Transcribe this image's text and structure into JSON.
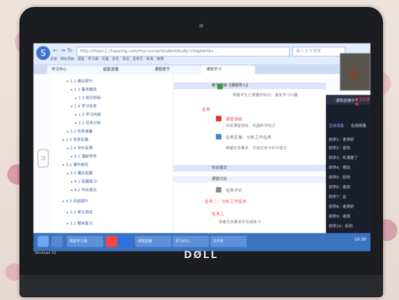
{
  "browser": {
    "logo_letter": "S",
    "nav_glyphs": "← → ↻",
    "address": "http://mooc1.chaoxing.com/mycourse/studentstudy?chapterId=...",
    "search_placeholder": "输入文字搜索",
    "bookmarks": "百度 · 网址导航 · 超星 · 学习通 · 天猫 · 京东 · 淘宝 · 爱奇艺 · 新浪 · 微博",
    "tabs": [
      "学习中心",
      "超星直播",
      "课程章节",
      "课程学习"
    ]
  },
  "tree": {
    "items": [
      "1.1 绪论部分",
      "1.2 基本概念",
      "1.3 知识目标",
      "1.4 学习任务",
      "1.5 学习内容",
      "2.1 任务分析",
      "2.2 任务准备",
      "2.3 任务实施",
      "2.4 评价反馈",
      "3.1 课前导学",
      "3.2 课中探究",
      "3.3 课后拓展",
      "4.1 拓展练习",
      "4.2 作业提交",
      "4.3 总结提升",
      "5.1 单元测试",
      "5.2 期末复习"
    ],
    "expand_glyph": "⊐"
  },
  "content": {
    "header_band": "教学视频【课程导入】",
    "intro_text": "观看学生已掌握的知识，激发学习兴趣",
    "section_title": "任务",
    "item1_title": "课堂测验",
    "item1_text": "完成课堂测验，巩固所学知识",
    "item2_title": "任务实施：分析工作任务",
    "item2_text": "根据任务要求，完成任务分析并提交",
    "band2": "作业提交",
    "band3": "课堂讨论",
    "item3_title": "任务评价",
    "item4_title": "任务二：分析工作任务",
    "item5_title": "任务三",
    "item5_text": "查看任务要求并完成练习"
  },
  "live_panel": {
    "host": "课程直播中",
    "badge": "● 正在直播",
    "tabs": [
      "互动消息",
      "在线观看"
    ],
    "messages": [
      "同学1：老师好",
      "同学2：收到",
      "同学3：听清楚了",
      "同学4：明白",
      "同学5：好的",
      "同学6：收到",
      "同学7：在",
      "同学8：老师好",
      "同学9：收到",
      "同学10：好的"
    ]
  },
  "taskbar": {
    "windows": [
      "超星学习通",
      "课程直播",
      "学习中心",
      "文件夹"
    ],
    "clock": "10:30"
  },
  "device": {
    "brand": "DØLL",
    "sticker": "Windows 10"
  },
  "colors": {
    "accent": "#3f6fc1",
    "live_panel": "#1a1d2a",
    "taskbar": "#3a6fb8"
  }
}
